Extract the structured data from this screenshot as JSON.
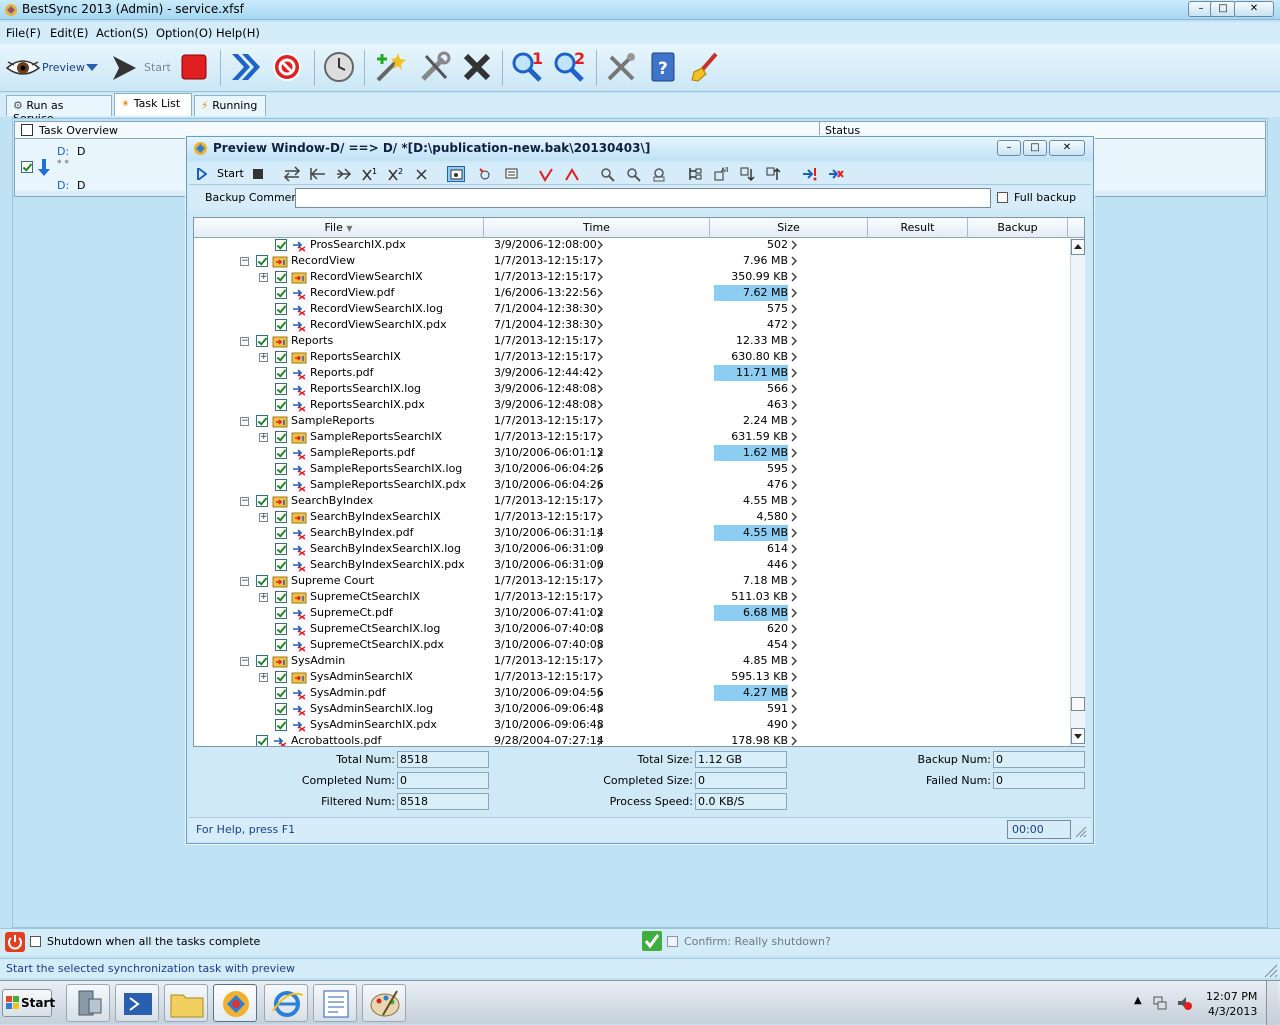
{
  "app": {
    "title": "BestSync 2013 (Admin) - service.xfsf",
    "window_buttons": {
      "min": "–",
      "max": "□",
      "close": "✕"
    }
  },
  "menu": [
    "File(F)",
    "Edit(E)",
    "Action(S)",
    "Option(O)",
    "Help(H)"
  ],
  "toolbar": {
    "preview_label": "Preview",
    "start_label": "Start"
  },
  "tabs": [
    "Run as Service",
    "Task List",
    "Running"
  ],
  "task_overview": {
    "header": "Task Overview",
    "status_header": "Status",
    "row": {
      "src_drive": "D:",
      "src_name": "D",
      "mid": "* *",
      "dst_drive": "D:",
      "dst_name": "D"
    }
  },
  "preview": {
    "title": "Preview Window-D/ ==> D/ *[D:\\publication-new.bak\\20130403\\]",
    "start_label": "Start",
    "backup_comment_label": "Backup Comment:",
    "backup_comment_value": "",
    "full_backup_label": "Full backup",
    "columns": [
      "File",
      "Time",
      "Size",
      "Result",
      "Backup"
    ],
    "rows": [
      {
        "level": 2,
        "expand": "",
        "name": "ProsSearchIX.pdx",
        "time": "3/9/2006-12:08:00",
        "size": "502",
        "hl": false,
        "folder": false
      },
      {
        "level": 1,
        "expand": "−",
        "name": "RecordView",
        "time": "1/7/2013-12:15:17",
        "size": "7.96 MB",
        "hl": false,
        "folder": true
      },
      {
        "level": 2,
        "expand": "+",
        "name": "RecordViewSearchIX",
        "time": "1/7/2013-12:15:17",
        "size": "350.99 KB",
        "hl": false,
        "folder": true
      },
      {
        "level": 2,
        "expand": "",
        "name": "RecordView.pdf",
        "time": "1/6/2006-13:22:56",
        "size": "7.62 MB",
        "hl": true,
        "folder": false
      },
      {
        "level": 2,
        "expand": "",
        "name": "RecordViewSearchIX.log",
        "time": "7/1/2004-12:38:30",
        "size": "575",
        "hl": false,
        "folder": false
      },
      {
        "level": 2,
        "expand": "",
        "name": "RecordViewSearchIX.pdx",
        "time": "7/1/2004-12:38:30",
        "size": "472",
        "hl": false,
        "folder": false
      },
      {
        "level": 1,
        "expand": "−",
        "name": "Reports",
        "time": "1/7/2013-12:15:17",
        "size": "12.33 MB",
        "hl": false,
        "folder": true
      },
      {
        "level": 2,
        "expand": "+",
        "name": "ReportsSearchIX",
        "time": "1/7/2013-12:15:17",
        "size": "630.80 KB",
        "hl": false,
        "folder": true
      },
      {
        "level": 2,
        "expand": "",
        "name": "Reports.pdf",
        "time": "3/9/2006-12:44:42",
        "size": "11.71 MB",
        "hl": true,
        "folder": false
      },
      {
        "level": 2,
        "expand": "",
        "name": "ReportsSearchIX.log",
        "time": "3/9/2006-12:48:08",
        "size": "566",
        "hl": false,
        "folder": false
      },
      {
        "level": 2,
        "expand": "",
        "name": "ReportsSearchIX.pdx",
        "time": "3/9/2006-12:48:08",
        "size": "463",
        "hl": false,
        "folder": false
      },
      {
        "level": 1,
        "expand": "−",
        "name": "SampleReports",
        "time": "1/7/2013-12:15:17",
        "size": "2.24 MB",
        "hl": false,
        "folder": true
      },
      {
        "level": 2,
        "expand": "+",
        "name": "SampleReportsSearchIX",
        "time": "1/7/2013-12:15:17",
        "size": "631.59 KB",
        "hl": false,
        "folder": true
      },
      {
        "level": 2,
        "expand": "",
        "name": "SampleReports.pdf",
        "time": "3/10/2006-06:01:12",
        "size": "1.62 MB",
        "hl": true,
        "folder": false
      },
      {
        "level": 2,
        "expand": "",
        "name": "SampleReportsSearchIX.log",
        "time": "3/10/2006-06:04:26",
        "size": "595",
        "hl": false,
        "folder": false
      },
      {
        "level": 2,
        "expand": "",
        "name": "SampleReportsSearchIX.pdx",
        "time": "3/10/2006-06:04:26",
        "size": "476",
        "hl": false,
        "folder": false
      },
      {
        "level": 1,
        "expand": "−",
        "name": "SearchByIndex",
        "time": "1/7/2013-12:15:17",
        "size": "4.55 MB",
        "hl": false,
        "folder": true
      },
      {
        "level": 2,
        "expand": "+",
        "name": "SearchByIndexSearchIX",
        "time": "1/7/2013-12:15:17",
        "size": "4,580",
        "hl": false,
        "folder": true
      },
      {
        "level": 2,
        "expand": "",
        "name": "SearchByIndex.pdf",
        "time": "3/10/2006-06:31:14",
        "size": "4.55 MB",
        "hl": true,
        "folder": false
      },
      {
        "level": 2,
        "expand": "",
        "name": "SearchByIndexSearchIX.log",
        "time": "3/10/2006-06:31:00",
        "size": "614",
        "hl": false,
        "folder": false
      },
      {
        "level": 2,
        "expand": "",
        "name": "SearchByIndexSearchIX.pdx",
        "time": "3/10/2006-06:31:00",
        "size": "446",
        "hl": false,
        "folder": false
      },
      {
        "level": 1,
        "expand": "−",
        "name": "Supreme Court",
        "time": "1/7/2013-12:15:17",
        "size": "7.18 MB",
        "hl": false,
        "folder": true
      },
      {
        "level": 2,
        "expand": "+",
        "name": "SupremeCtSearchIX",
        "time": "1/7/2013-12:15:17",
        "size": "511.03 KB",
        "hl": false,
        "folder": true
      },
      {
        "level": 2,
        "expand": "",
        "name": "SupremeCt.pdf",
        "time": "3/10/2006-07:41:02",
        "size": "6.68 MB",
        "hl": true,
        "folder": false
      },
      {
        "level": 2,
        "expand": "",
        "name": "SupremeCtSearchIX.log",
        "time": "3/10/2006-07:40:08",
        "size": "620",
        "hl": false,
        "folder": false
      },
      {
        "level": 2,
        "expand": "",
        "name": "SupremeCtSearchIX.pdx",
        "time": "3/10/2006-07:40:08",
        "size": "454",
        "hl": false,
        "folder": false
      },
      {
        "level": 1,
        "expand": "−",
        "name": "SysAdmin",
        "time": "1/7/2013-12:15:17",
        "size": "4.85 MB",
        "hl": false,
        "folder": true
      },
      {
        "level": 2,
        "expand": "+",
        "name": "SysAdminSearchIX",
        "time": "1/7/2013-12:15:17",
        "size": "595.13 KB",
        "hl": false,
        "folder": true
      },
      {
        "level": 2,
        "expand": "",
        "name": "SysAdmin.pdf",
        "time": "3/10/2006-09:04:56",
        "size": "4.27 MB",
        "hl": true,
        "folder": false
      },
      {
        "level": 2,
        "expand": "",
        "name": "SysAdminSearchIX.log",
        "time": "3/10/2006-09:06:48",
        "size": "591",
        "hl": false,
        "folder": false
      },
      {
        "level": 2,
        "expand": "",
        "name": "SysAdminSearchIX.pdx",
        "time": "3/10/2006-09:06:48",
        "size": "490",
        "hl": false,
        "folder": false
      },
      {
        "level": 1,
        "expand": "",
        "name": "Acrobattools.pdf",
        "time": "9/28/2004-07:27:14",
        "size": "178.98 KB",
        "hl": false,
        "folder": false
      }
    ],
    "stats": {
      "total_num_label": "Total Num:",
      "total_num": "8518",
      "completed_num_label": "Completed Num:",
      "completed_num": "0",
      "filtered_num_label": "Filtered Num:",
      "filtered_num": "8518",
      "total_size_label": "Total Size:",
      "total_size": "1.12 GB",
      "completed_size_label": "Completed Size:",
      "completed_size": "0",
      "process_speed_label": "Process Speed:",
      "process_speed": "0.0 KB/S",
      "backup_num_label": "Backup Num:",
      "backup_num": "0",
      "failed_num_label": "Failed Num:",
      "failed_num": "0"
    },
    "status_text": "For Help, press F1",
    "timer": "00:00"
  },
  "bottom": {
    "shutdown_label": "Shutdown when all the tasks complete",
    "confirm_label": "Confirm: Really shutdown?",
    "status": "Start the selected synchronization task with preview"
  },
  "taskbar": {
    "start": "Start",
    "time": "12:07 PM",
    "date": "4/3/2013"
  },
  "colors": {
    "highlight": "#8ecdf2",
    "accent": "#1f5fbf"
  }
}
